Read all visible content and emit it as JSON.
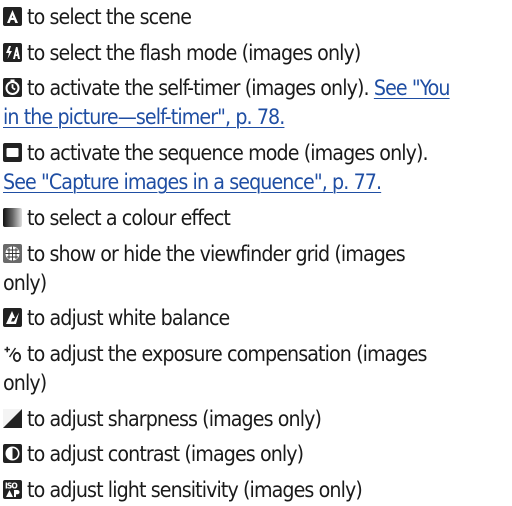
{
  "items": [
    {
      "icon": "scene-icon",
      "text": "to select the scene"
    },
    {
      "icon": "flash-mode-icon",
      "text": "to select the flash mode (images only)"
    },
    {
      "icon": "self-timer-icon",
      "text": "to activate the self-timer (images only).",
      "link_line1": "See \"You",
      "link_line2": "in the picture—self-timer\", p. 78."
    },
    {
      "icon": "sequence-mode-icon",
      "text": "to activate the sequence mode (images only).",
      "link_line2": "See \"Capture images in a sequence\", p. 77."
    },
    {
      "icon": "colour-effect-icon",
      "text": "to select a colour effect"
    },
    {
      "icon": "viewfinder-grid-icon",
      "text": "to show or hide the viewfinder grid (images",
      "text_line2": "only)"
    },
    {
      "icon": "white-balance-icon",
      "text": "to adjust white balance"
    },
    {
      "icon": "exposure-compensation-icon",
      "text": "to adjust the exposure compensation (images",
      "text_line2": "only)"
    },
    {
      "icon": "sharpness-icon",
      "text": "to adjust sharpness (images only)"
    },
    {
      "icon": "contrast-icon",
      "text": "to adjust contrast (images only)"
    },
    {
      "icon": "light-sensitivity-icon",
      "text": "to adjust light sensitivity (images only)"
    }
  ]
}
